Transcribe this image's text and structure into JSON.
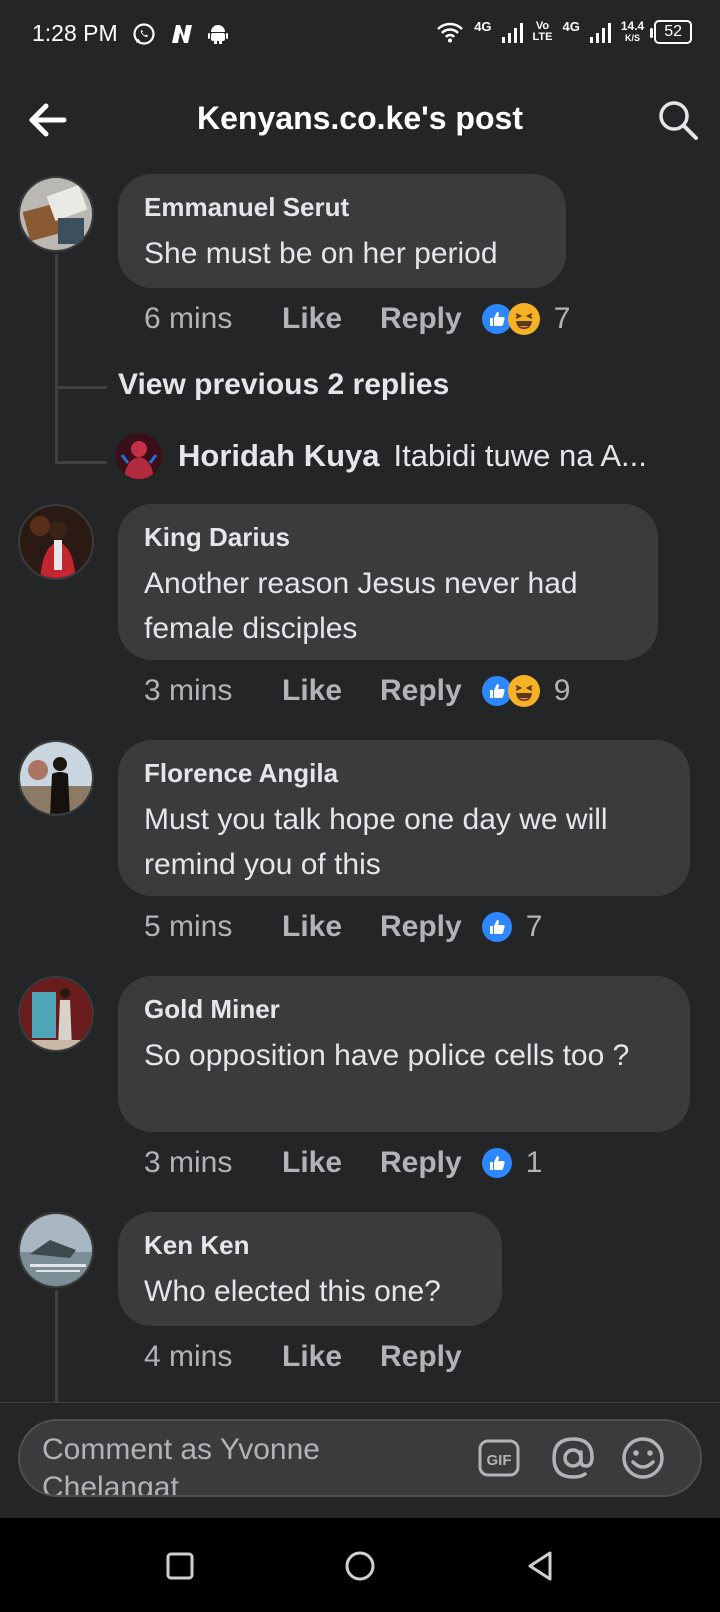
{
  "status": {
    "time": "1:28 PM",
    "net1": "4G",
    "volte_top": "Vo",
    "volte_bottom": "LTE",
    "net2": "4G",
    "speed_top": "14.4",
    "speed_bottom": "K/S",
    "battery": "52"
  },
  "header": {
    "title": "Kenyans.co.ke's post"
  },
  "comments": [
    {
      "author": "Emmanuel Serut",
      "text": "She must be on her period",
      "time": "6 mins",
      "like": "Like",
      "reply": "Reply",
      "reactions": [
        "like",
        "haha"
      ],
      "count": "7"
    },
    {
      "author": "King Darius",
      "text": "Another reason Jesus never had female disciples",
      "time": "3 mins",
      "like": "Like",
      "reply": "Reply",
      "reactions": [
        "like",
        "haha"
      ],
      "count": "9"
    },
    {
      "author": "Florence Angila",
      "text": "Must you talk hope one day we will remind you of this",
      "time": "5 mins",
      "like": "Like",
      "reply": "Reply",
      "reactions": [
        "like"
      ],
      "count": "7"
    },
    {
      "author": "Gold Miner",
      "text": "So opposition have police cells too ?",
      "time": "3 mins",
      "like": "Like",
      "reply": "Reply",
      "reactions": [
        "like"
      ],
      "count": "1"
    },
    {
      "author": "Ken Ken",
      "text": "Who elected this one?",
      "time": "4 mins",
      "like": "Like",
      "reply": "Reply"
    }
  ],
  "thread": {
    "view_previous": "View previous 2 replies",
    "reply_author": "Horidah Kuya",
    "reply_text": "Itabidi tuwe na A..."
  },
  "composer": {
    "placeholder": "Comment as Yvonne Chelangat",
    "gif_label": "GIF"
  },
  "colors": {
    "accent": "#2d88ff",
    "haha": "#f7b125",
    "background": "#242526",
    "bubble": "#3a3b3c"
  }
}
